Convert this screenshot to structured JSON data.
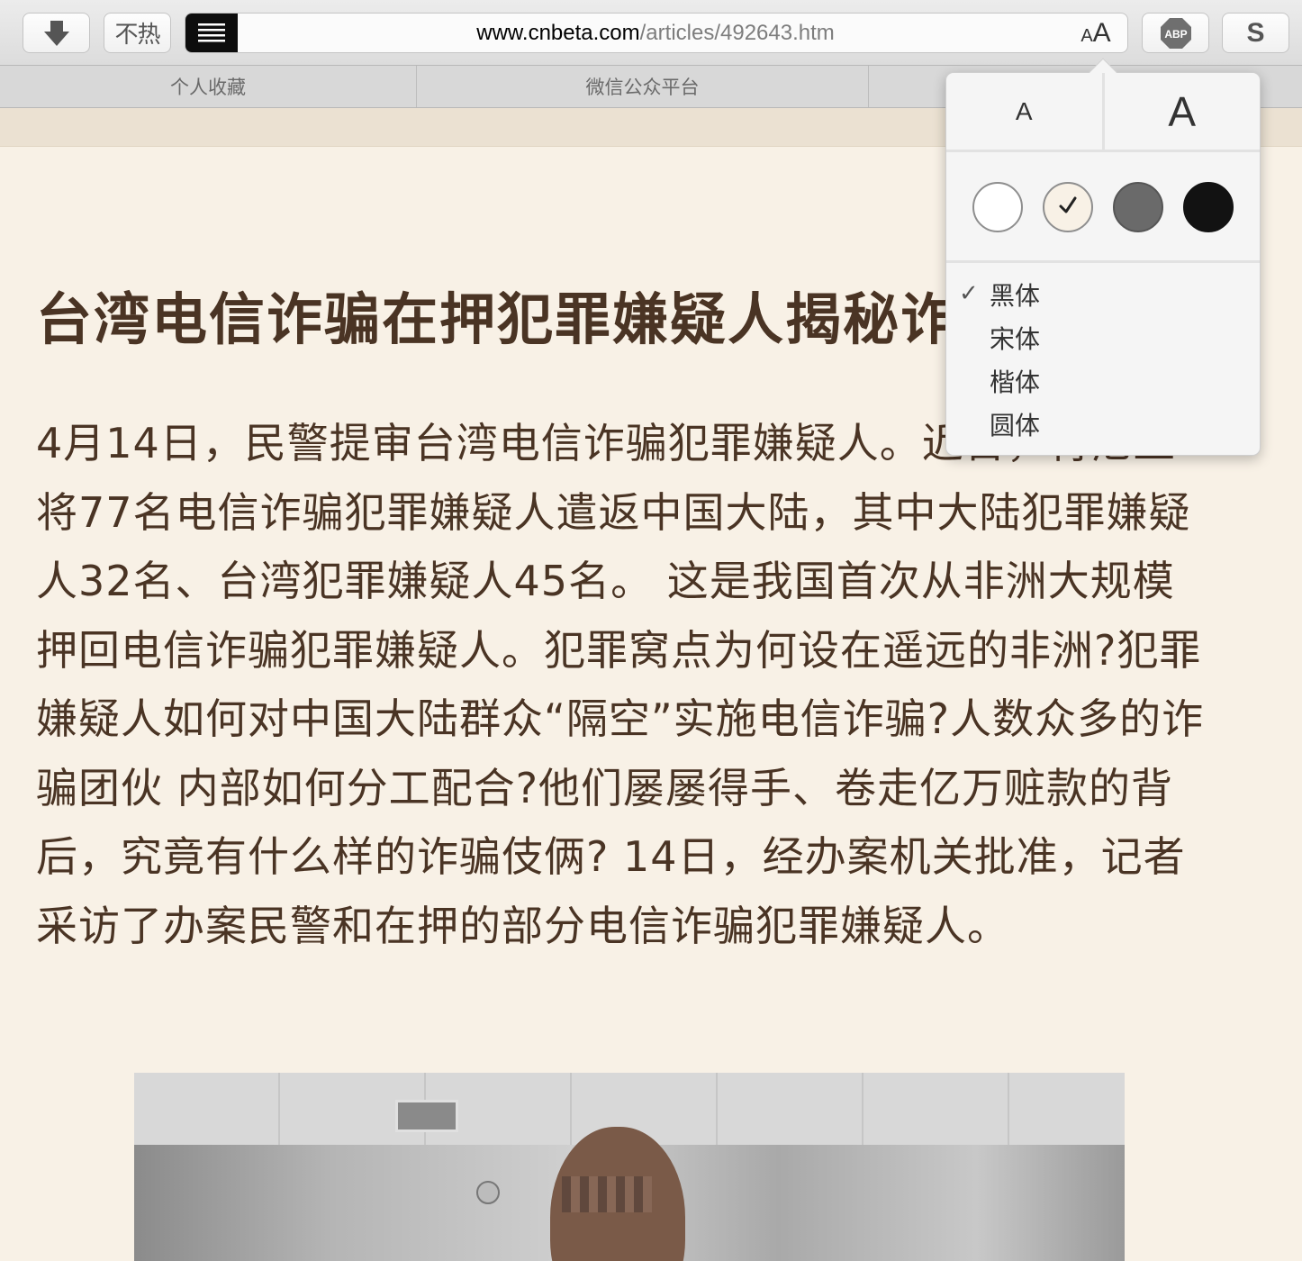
{
  "toolbar": {
    "download_icon": "download-arrow-icon",
    "buhot_label": "不热",
    "reader_icon": "reader-view-icon",
    "url_host": "www.cnbeta.com",
    "url_path": "/articles/492643.htm",
    "text_size_small": "A",
    "text_size_big": "A",
    "abp_label": "ABP",
    "s_label": "S"
  },
  "bookmarks": [
    "个人收藏",
    "微信公众平台",
    ""
  ],
  "popover": {
    "size_small": "A",
    "size_big": "A",
    "themes": [
      {
        "name": "white",
        "color": "#ffffff",
        "selected": false
      },
      {
        "name": "sepia",
        "color": "#f8f1e6",
        "selected": true
      },
      {
        "name": "gray",
        "color": "#6a6a6a",
        "selected": false
      },
      {
        "name": "black",
        "color": "#121212",
        "selected": false
      }
    ],
    "check_mark": "✓",
    "fonts": [
      {
        "label": "黑体",
        "selected": true
      },
      {
        "label": "宋体",
        "selected": false
      },
      {
        "label": "楷体",
        "selected": false
      },
      {
        "label": "圆体",
        "selected": false
      }
    ]
  },
  "article": {
    "title": "台湾电信诈骗在押犯罪嫌疑人揭秘诈骗伎俩",
    "body": "4月14日，民警提审台湾电信诈骗犯罪嫌疑人。近日，肯尼亚将77名电信诈骗犯罪嫌疑人遣返中国大陆，其中大陆犯罪嫌疑人32名、台湾犯罪嫌疑人45名。 这是我国首次从非洲大规模押回电信诈骗犯罪嫌疑人。犯罪窝点为何设在遥远的非洲?犯罪嫌疑人如何对中国大陆群众“隔空”实施电信诈骗?人数众多的诈骗团伙 内部如何分工配合?他们屡屡得手、卷走亿万赃款的背后，究竟有什么样的诈骗伎俩? 14日，经办案机关批准，记者采访了办案民警和在押的部分电信诈骗犯罪嫌疑人。"
  },
  "colors": {
    "page_bg": "#f8f1e6",
    "text": "#4a3424"
  }
}
